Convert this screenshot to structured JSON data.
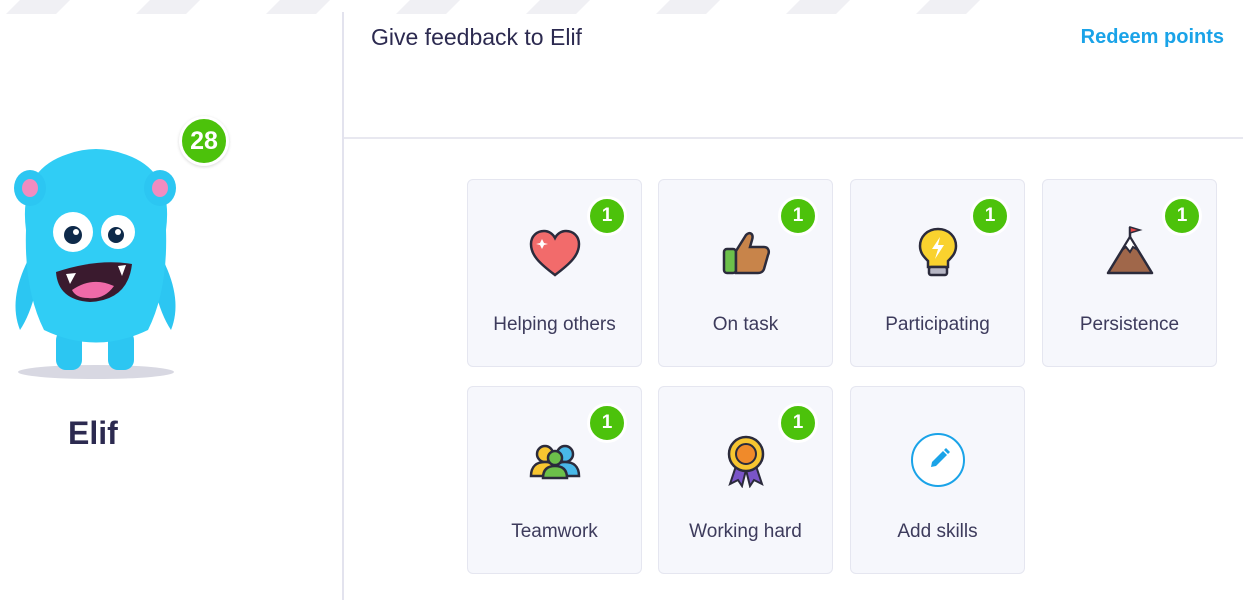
{
  "header": {
    "title": "Give feedback to Elif",
    "redeem_label": "Redeem points"
  },
  "student": {
    "name": "Elif",
    "points": "28"
  },
  "skills": [
    {
      "label": "Helping others",
      "count": "1",
      "icon": "heart-icon"
    },
    {
      "label": "On task",
      "count": "1",
      "icon": "thumbs-up-icon"
    },
    {
      "label": "Participating",
      "count": "1",
      "icon": "lightbulb-icon"
    },
    {
      "label": "Persistence",
      "count": "1",
      "icon": "mountain-icon"
    },
    {
      "label": "Teamwork",
      "count": "1",
      "icon": "team-icon"
    },
    {
      "label": "Working hard",
      "count": "1",
      "icon": "medal-icon"
    }
  ],
  "add_skill": {
    "label": "Add skills",
    "icon": "pencil-icon"
  },
  "colors": {
    "accent_blue": "#1aa3e8",
    "badge_green": "#4cc20b",
    "card_bg": "#f6f7fc",
    "text_dark": "#2c2a50"
  }
}
